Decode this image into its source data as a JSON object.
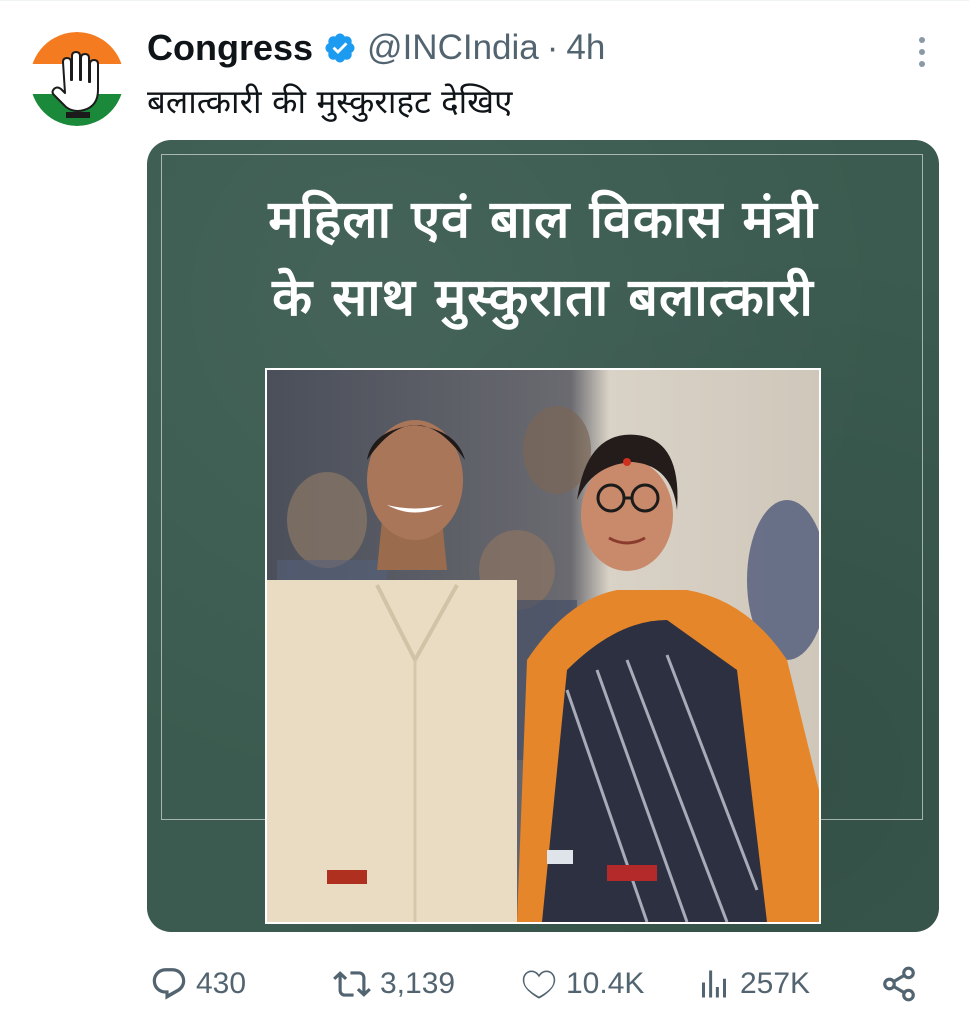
{
  "tweet": {
    "author": {
      "display_name": "Congress",
      "handle": "@INCIndia",
      "separator": "·",
      "time": "4h"
    },
    "text": "बलात्कारी की मुस्कुराहट देखिए"
  },
  "media": {
    "headline_line1": "महिला एवं बाल विकास मंत्री",
    "headline_line2": "के साथ मुस्कुराता बलात्कारी",
    "background_color": "#3b5b50"
  },
  "actions": {
    "replies": "430",
    "reposts": "3,139",
    "likes": "10.4K",
    "views": "257K"
  },
  "icons": {
    "verified": "verified-badge-icon",
    "more": "more-vertical-icon",
    "reply": "reply-icon",
    "repost": "repost-icon",
    "like": "heart-icon",
    "views": "views-icon",
    "share": "share-icon"
  },
  "colors": {
    "verified_blue": "#1d9bf0",
    "secondary_text": "#536471",
    "saffron": "#f47b20",
    "green": "#1a8a3a"
  }
}
